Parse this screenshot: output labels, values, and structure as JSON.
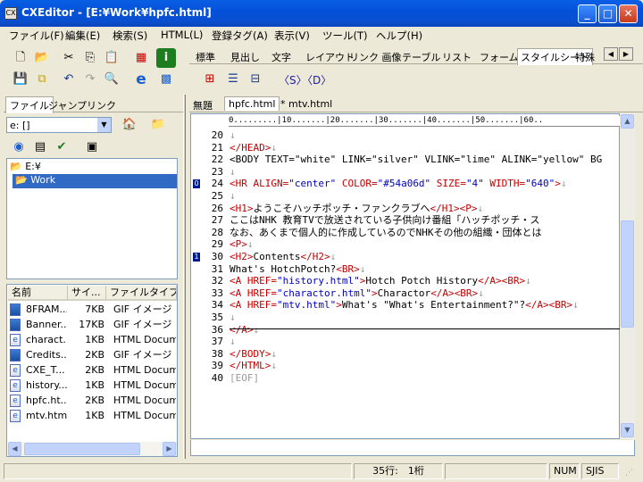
{
  "window": {
    "title": "CXEditor - [E:¥Work¥hpfc.html]",
    "min": "_",
    "max": "□",
    "close": "✕"
  },
  "menu": [
    "ファイル(F)",
    "編集(E)",
    "検索(S)",
    "HTML(L)",
    "登録タグ(A)",
    "表示(V)",
    "ツール(T)",
    "ヘルプ(H)"
  ],
  "tag_tabs": [
    "標準",
    "見出し",
    "文字",
    "レイアウト",
    "リンク 画像",
    "テーブル",
    "リスト",
    "フォーム",
    "スタイルシート",
    "特殊"
  ],
  "tag_toolbar": {
    "s_tag": "〈S〉",
    "d_tag": "〈D〉"
  },
  "left_tabs": [
    "ファイル",
    "ジャンプ",
    "リンク"
  ],
  "drive": {
    "value": "e: []"
  },
  "tree": [
    {
      "label": "E:¥"
    },
    {
      "label": "Work"
    }
  ],
  "file_columns": [
    "名前",
    "サイ...",
    "ファイルタイプ"
  ],
  "files": [
    {
      "name": "8FRAM...",
      "size": "7KB",
      "type": "GIF イメージ",
      "icon": "gif"
    },
    {
      "name": "Banner...",
      "size": "17KB",
      "type": "GIF イメージ",
      "icon": "gif"
    },
    {
      "name": "charact...",
      "size": "1KB",
      "type": "HTML Docume",
      "icon": "html"
    },
    {
      "name": "Credits...",
      "size": "2KB",
      "type": "GIF イメージ",
      "icon": "gif"
    },
    {
      "name": "CXE_T...",
      "size": "2KB",
      "type": "HTML Docume",
      "icon": "html"
    },
    {
      "name": "history...",
      "size": "1KB",
      "type": "HTML Docume",
      "icon": "html"
    },
    {
      "name": "hpfc.ht...",
      "size": "2KB",
      "type": "HTML Docume",
      "icon": "html"
    },
    {
      "name": "mtv.html",
      "size": "1KB",
      "type": "HTML Docume",
      "icon": "html"
    }
  ],
  "doc_tabs": [
    "無題",
    "hpfc.html",
    "* mtv.html"
  ],
  "ruler": "0.........|10.......|20.......|30.......|40.......|50.......|60..",
  "lines": [
    {
      "n": "20",
      "text": "↓",
      "kind": "nl"
    },
    {
      "n": "21",
      "text": "</HEAD>↓",
      "kind": "tag"
    },
    {
      "n": "22",
      "text": "<BODY TEXT=\"white\" LINK=\"silver\" VLINK=\"lime\" ALINK=\"yellow\" BG",
      "kind": "tag"
    },
    {
      "n": "23",
      "text": "↓",
      "kind": "nl"
    },
    {
      "n": "24",
      "text": "<HR ALIGN=\"center\" COLOR=\"#54a06d\" SIZE=\"4\" WIDTH=\"640\">↓",
      "kind": "tag",
      "marker": "0"
    },
    {
      "n": "25",
      "text": "↓",
      "kind": "nl"
    },
    {
      "n": "26",
      "text": "<H1>ようこそハッチポッチ・ファンクラブへ</H1><P>↓",
      "kind": "mixed"
    },
    {
      "n": "27",
      "text": "ここはNHK 教育TVで放送されている子供向け番組「ハッチポッチ・ス",
      "kind": "text"
    },
    {
      "n": "28",
      "text": "なお、あくまで個人的に作成しているのでNHKその他の組織・団体とは",
      "kind": "text"
    },
    {
      "n": "29",
      "text": "<P>↓",
      "kind": "tag"
    },
    {
      "n": "30",
      "text": "<H2>Contents</H2>↓",
      "kind": "mixed",
      "marker": "1"
    },
    {
      "n": "31",
      "text": "What's HotchPotch?<BR>↓",
      "kind": "mixed"
    },
    {
      "n": "32",
      "text": "<A HREF=\"history.html\">Hotch Potch History</A><BR>↓",
      "kind": "mixed"
    },
    {
      "n": "33",
      "text": "<A HREF=\"charactor.html\">Charactor</A><BR>↓",
      "kind": "mixed"
    },
    {
      "n": "34",
      "text": "<A HREF=\"mtv.html\">What's \"What's Entertainment?\"?</A><BR>↓",
      "kind": "mixed"
    },
    {
      "n": "35",
      "text": "↓",
      "kind": "nl"
    },
    {
      "n": "36",
      "text": "</A>↓",
      "kind": "tag"
    },
    {
      "n": "37",
      "text": "↓",
      "kind": "nl"
    },
    {
      "n": "38",
      "text": "</BODY>↓",
      "kind": "tag"
    },
    {
      "n": "39",
      "text": "</HTML>↓",
      "kind": "tag"
    },
    {
      "n": "40",
      "text": "[EOF]",
      "kind": "eof"
    }
  ],
  "status": {
    "pos": "35行:　1桁",
    "num": "NUM",
    "enc": "SJIS"
  },
  "colors": {
    "tag": "#c00000",
    "value": "#0000c0",
    "newline": "#9a9a9a",
    "selection": "#316ac5"
  }
}
